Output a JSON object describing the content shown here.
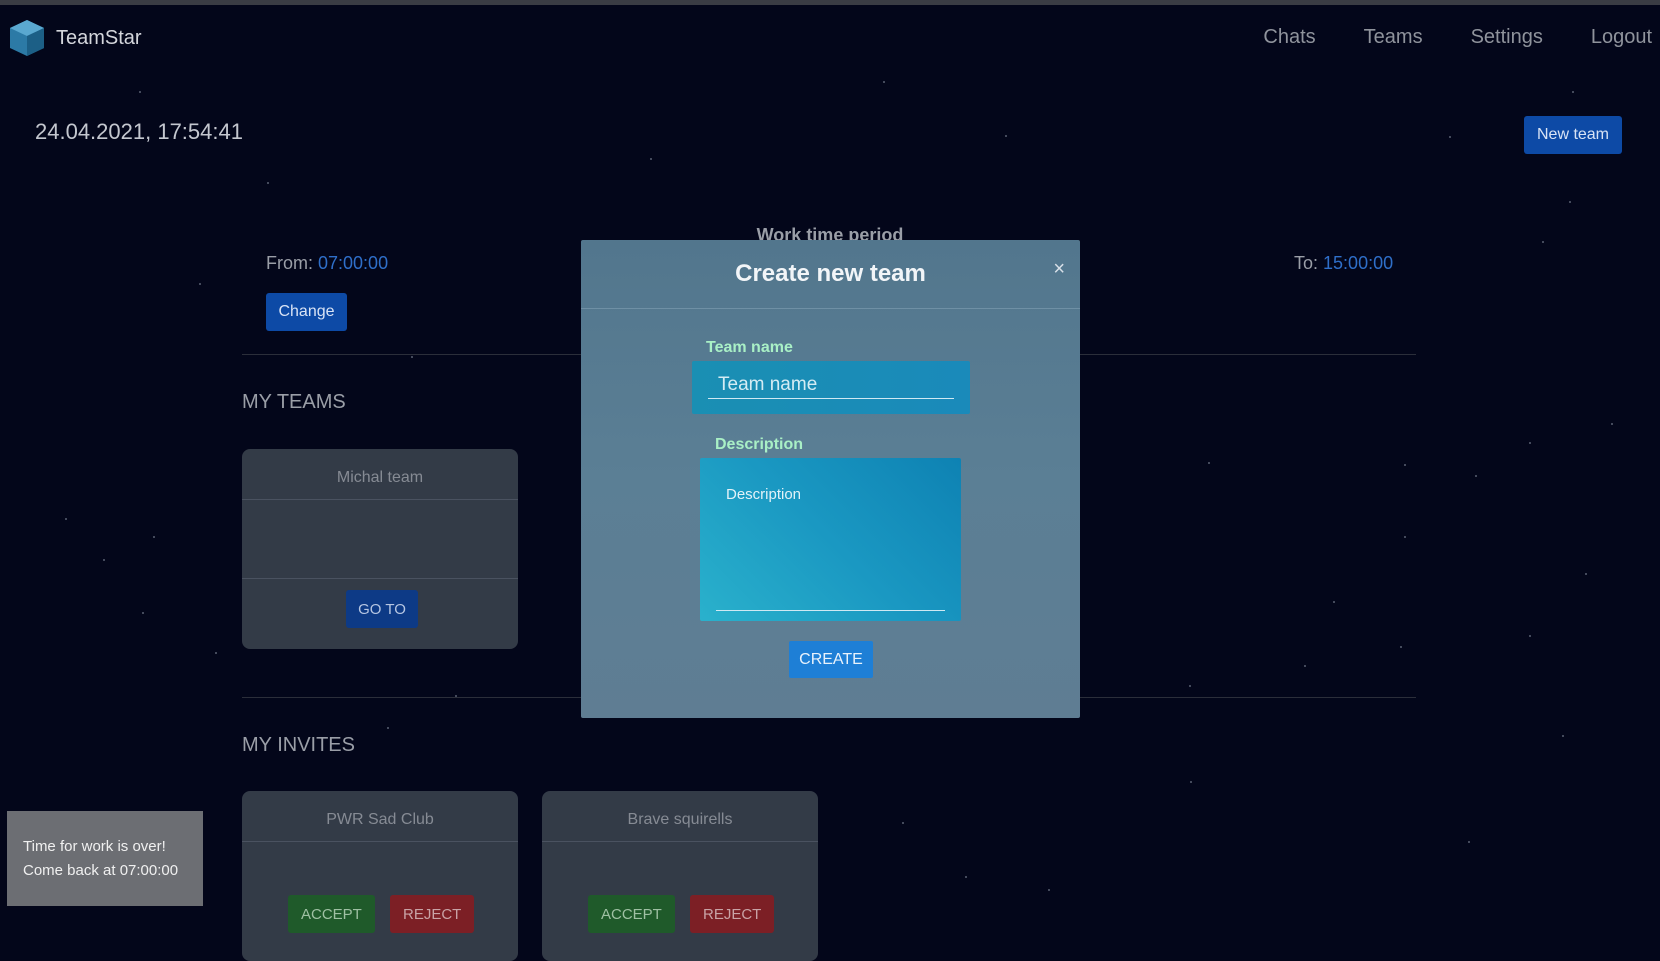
{
  "brand": {
    "name": "TeamStar"
  },
  "nav": {
    "items": [
      "Chats",
      "Teams",
      "Settings",
      "Logout"
    ]
  },
  "header": {
    "datetime": "24.04.2021, 17:54:41",
    "new_team_label": "New team"
  },
  "work_time": {
    "title": "Work time period",
    "from_label": "From:",
    "from_value": "07:00:00",
    "to_label": "To:",
    "to_value": "15:00:00",
    "change_label": "Change"
  },
  "my_teams": {
    "title": "MY TEAMS",
    "teams": [
      {
        "name": "Michal team",
        "goto_label": "GO TO"
      }
    ]
  },
  "my_invites": {
    "title": "MY INVITES",
    "invites": [
      {
        "name": "PWR Sad Club",
        "accept_label": "ACCEPT",
        "reject_label": "REJECT"
      },
      {
        "name": "Brave squirells",
        "accept_label": "ACCEPT",
        "reject_label": "REJECT"
      }
    ]
  },
  "toast": {
    "line1": "Time for work is over!",
    "line2": "Come back at 07:00:00"
  },
  "modal": {
    "title": "Create new team",
    "close_glyph": "×",
    "team_name_label": "Team name",
    "team_name_placeholder": "Team name",
    "team_name_value": "",
    "description_label": "Description",
    "description_placeholder": "Description",
    "description_value": "",
    "create_label": "CREATE"
  },
  "colors": {
    "background": "#03061a",
    "primary_button": "#0d4aa6",
    "link_time": "#2f6fc9",
    "accept": "#1f5a2a",
    "reject": "#7c1f25",
    "modal_label": "#a9f0c6",
    "create_button": "#1e7fd6"
  }
}
